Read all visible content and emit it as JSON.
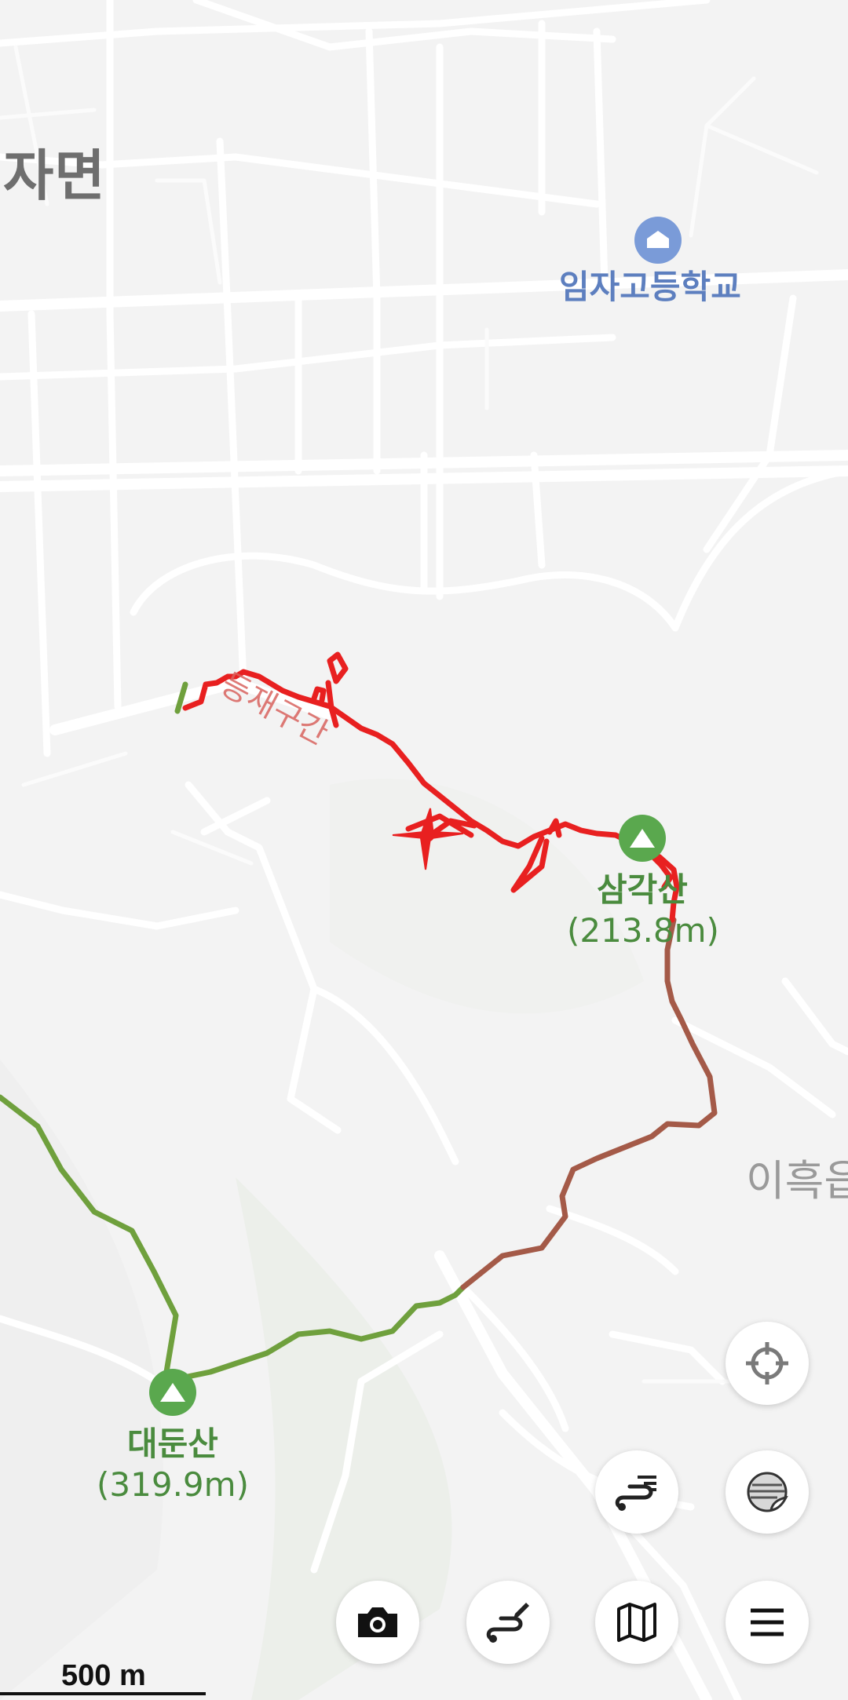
{
  "map": {
    "district_label": "자면",
    "district_label_right": "이흑읍",
    "school_label": "임자고등학교",
    "trail_label": "등재구간",
    "peaks": [
      {
        "name": "삼각산",
        "elevation": "(213.8m)"
      },
      {
        "name": "대둔산",
        "elevation": "(319.9m)"
      }
    ],
    "scale_label": "500 m",
    "colors": {
      "background": "#f3f3f3",
      "road": "#ffffff",
      "recorded_track": "#e82020",
      "trail_green": "#6fa03d",
      "trail_brown": "#a45a48",
      "peak_marker": "#5aa84e",
      "school_marker": "#7a9bd8"
    }
  },
  "controls": {
    "locate": "crosshair-icon",
    "layers": "layers-icon",
    "route_list": "route-list-icon",
    "camera": "camera-icon",
    "route_edit": "route-edit-icon",
    "map": "map-icon",
    "menu": "menu-icon"
  }
}
